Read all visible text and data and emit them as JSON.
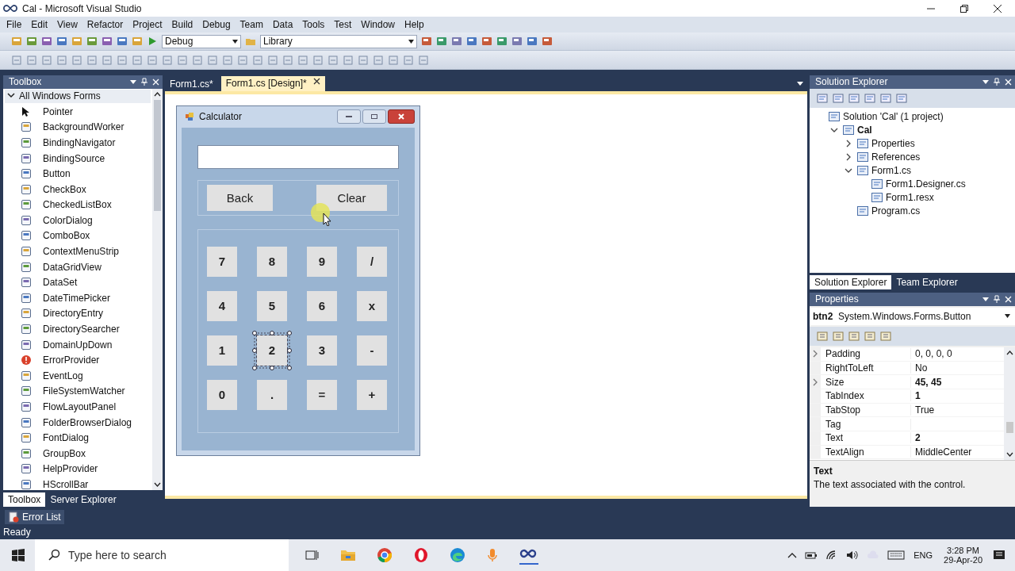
{
  "window": {
    "title": "Cal - Microsoft Visual Studio"
  },
  "menu": [
    "File",
    "Edit",
    "View",
    "Refactor",
    "Project",
    "Build",
    "Debug",
    "Team",
    "Data",
    "Tools",
    "Test",
    "Window",
    "Help"
  ],
  "toolbar": {
    "configuration": "Debug",
    "project": "Library"
  },
  "toolbox": {
    "title": "Toolbox",
    "group": {
      "label": "All Windows Forms",
      "expanded": true
    },
    "items": [
      "Pointer",
      "BackgroundWorker",
      "BindingNavigator",
      "BindingSource",
      "Button",
      "CheckBox",
      "CheckedListBox",
      "ColorDialog",
      "ComboBox",
      "ContextMenuStrip",
      "DataGridView",
      "DataSet",
      "DateTimePicker",
      "DirectoryEntry",
      "DirectorySearcher",
      "DomainUpDown",
      "ErrorProvider",
      "EventLog",
      "FileSystemWatcher",
      "FlowLayoutPanel",
      "FolderBrowserDialog",
      "FontDialog",
      "GroupBox",
      "HelpProvider",
      "HScrollBar"
    ],
    "tabs": [
      {
        "label": "Toolbox",
        "selected": true
      },
      {
        "label": "Server Explorer",
        "selected": false
      }
    ]
  },
  "document_tabs": [
    {
      "label": "Form1.cs*",
      "selected": false
    },
    {
      "label": "Form1.cs [Design]*",
      "selected": true
    }
  ],
  "form": {
    "title": "Calculator",
    "top_buttons": [
      "Back",
      "Clear"
    ],
    "keys": [
      [
        {
          "label": "7",
          "selected": false
        },
        {
          "label": "8",
          "selected": false
        },
        {
          "label": "9",
          "selected": false
        },
        {
          "label": "/",
          "selected": false
        }
      ],
      [
        {
          "label": "4",
          "selected": false
        },
        {
          "label": "5",
          "selected": false
        },
        {
          "label": "6",
          "selected": false
        },
        {
          "label": "x",
          "selected": false
        }
      ],
      [
        {
          "label": "1",
          "selected": false
        },
        {
          "label": "2",
          "selected": true
        },
        {
          "label": "3",
          "selected": false
        },
        {
          "label": "-",
          "selected": false
        }
      ],
      [
        {
          "label": "0",
          "selected": false
        },
        {
          "label": ".",
          "selected": false
        },
        {
          "label": "=",
          "selected": false
        },
        {
          "label": "+",
          "selected": false
        }
      ]
    ]
  },
  "solution_explorer": {
    "title": "Solution Explorer",
    "tree": [
      {
        "label": "Solution 'Cal' (1 project)",
        "children": [
          {
            "label": "Cal",
            "expanded": true,
            "children": [
              {
                "label": "Properties",
                "expanded": false
              },
              {
                "label": "References",
                "expanded": false
              },
              {
                "label": "Form1.cs",
                "expanded": true,
                "children": [
                  {
                    "label": "Form1.Designer.cs"
                  },
                  {
                    "label": "Form1.resx"
                  }
                ]
              },
              {
                "label": "Program.cs"
              }
            ]
          }
        ]
      }
    ],
    "tabs": [
      {
        "label": "Solution Explorer",
        "selected": true
      },
      {
        "label": "Team Explorer",
        "selected": false
      }
    ]
  },
  "properties": {
    "title": "Properties",
    "object": "btn2",
    "type": "System.Windows.Forms.Button",
    "rows": [
      {
        "name": "Padding",
        "value": "0, 0, 0, 0",
        "expandable": true,
        "modified": false
      },
      {
        "name": "RightToLeft",
        "value": "No",
        "expandable": false,
        "modified": false
      },
      {
        "name": "Size",
        "value": "45, 45",
        "expandable": true,
        "modified": true
      },
      {
        "name": "TabIndex",
        "value": "1",
        "expandable": false,
        "modified": true
      },
      {
        "name": "TabStop",
        "value": "True",
        "expandable": false,
        "modified": false
      },
      {
        "name": "Tag",
        "expandable": false
      },
      {
        "name": "Text",
        "value": "2",
        "expandable": false,
        "modified": true
      },
      {
        "name": "TextAlign",
        "value": "MiddleCenter",
        "expandable": false,
        "modified": false
      }
    ],
    "description_title": "Text",
    "description": "The text associated with the control."
  },
  "error_list": "Error List",
  "status": "Ready",
  "taskbar": {
    "search_placeholder": "Type here to search",
    "language": "ENG",
    "time": "3:28 PM",
    "date": "29-Apr-20"
  }
}
